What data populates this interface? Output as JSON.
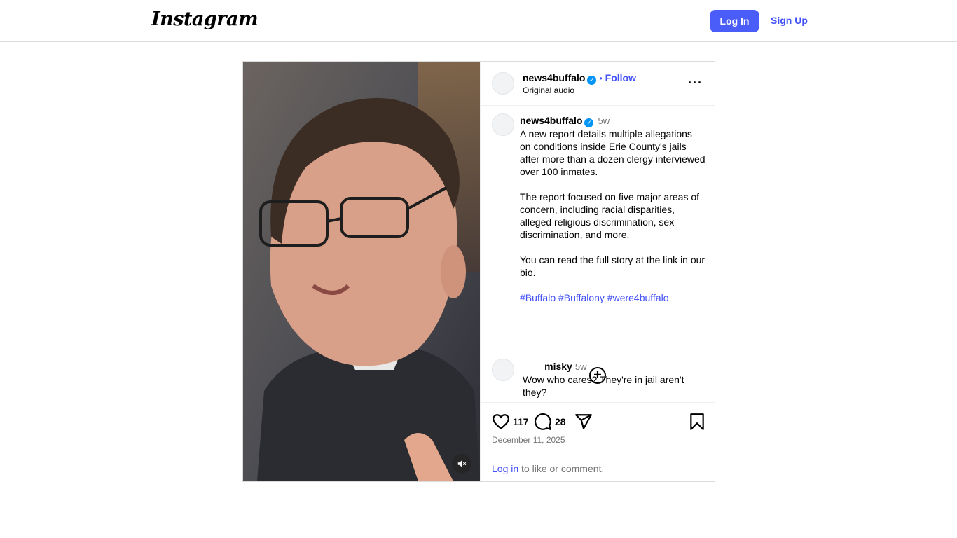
{
  "header": {
    "logo": "Instagram",
    "login_label": "Log In",
    "signup_label": "Sign Up"
  },
  "post": {
    "author": "news4buffalo",
    "follow_label": "Follow",
    "audio": "Original audio",
    "caption": {
      "author": "news4buffalo",
      "time": "5w",
      "paragraph1": "A new report details multiple allegations on conditions inside Erie County's jails after more than a dozen clergy interviewed over 100 inmates.",
      "paragraph2": "The report focused on five major areas of concern, including racial disparities, alleged religious discrimination, sex discrimination, and more.",
      "paragraph3": "You can read the full story at the link in our bio.",
      "hashtags": "#Buffalo #Buffalony #were4buffalo"
    },
    "comments": [
      {
        "author": "____misky",
        "time": "5w",
        "text": "Wow who cares? They're in jail aren't they?"
      }
    ],
    "likes": "117",
    "comment_count": "28",
    "date": "December 11, 2025",
    "login_prompt_link": "Log in",
    "login_prompt_rest": " to like or comment."
  },
  "icons": {
    "more": "more-options-icon",
    "verified": "verified-badge-icon",
    "load_more": "plus-circle-icon",
    "like": "heart-icon",
    "comment": "comment-icon",
    "share": "send-icon",
    "save": "bookmark-icon",
    "mute": "muted-speaker-icon"
  }
}
